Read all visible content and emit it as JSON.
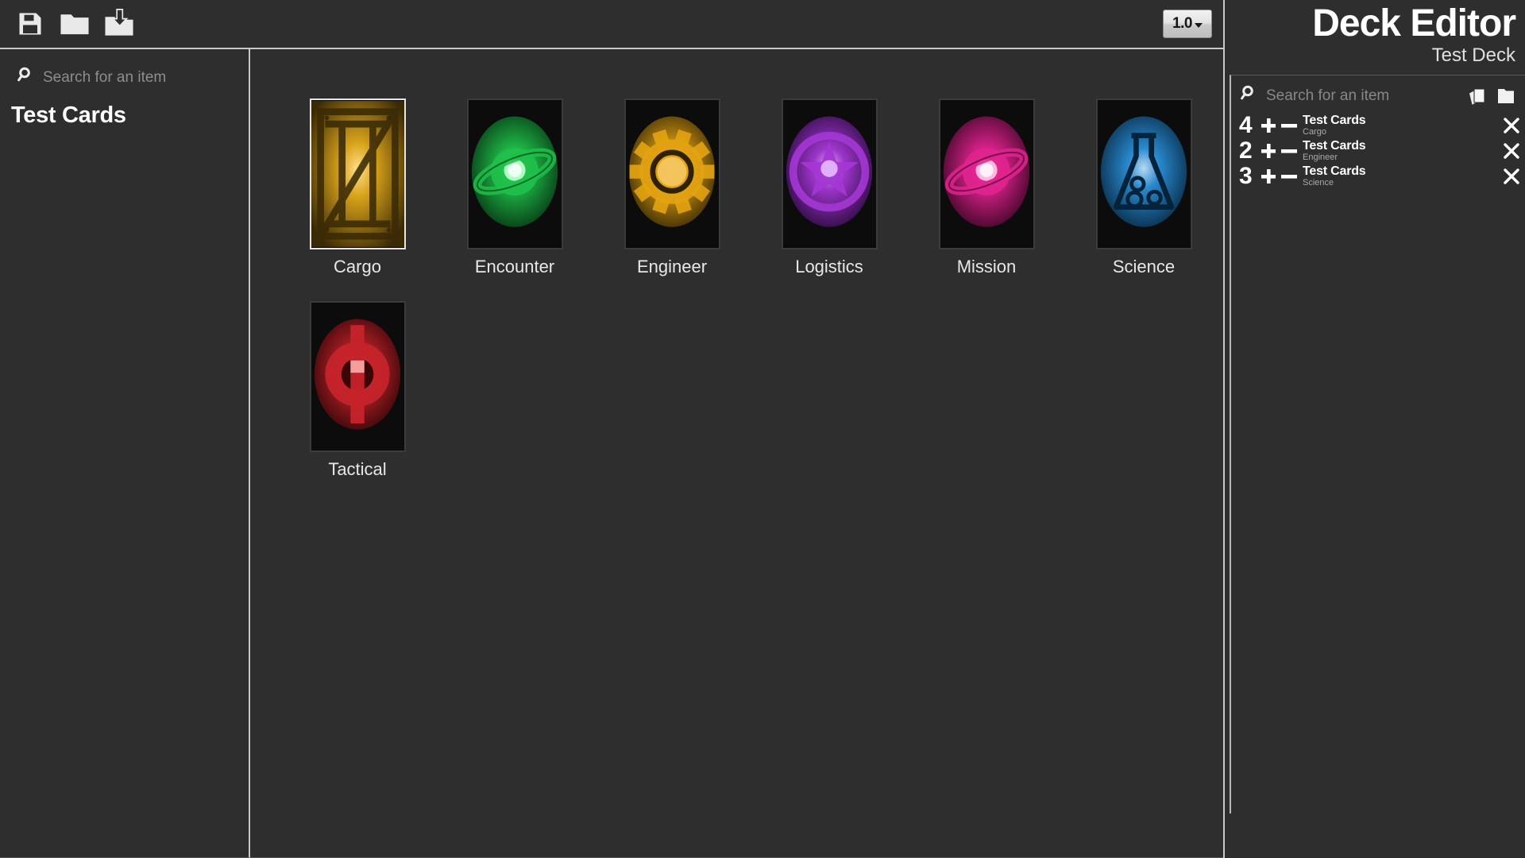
{
  "window": {
    "title": "Deck Editor",
    "background": "#2b2b2b",
    "panel_bg": "#2e2e2e",
    "divider": "#c9c9c9"
  },
  "toolbar": {
    "save_icon": "save-icon",
    "open_icon": "folder-open-icon",
    "import_icon": "import-icon",
    "version": {
      "label": "1.0",
      "caret": "chevron-down-icon"
    }
  },
  "sidebar": {
    "search": {
      "icon": "search-icon",
      "placeholder": "Search for an item",
      "value": ""
    },
    "heading": "Test Cards"
  },
  "grid": {
    "cards": [
      {
        "label": "Cargo",
        "art": "crate-icon",
        "color": "#d9a31a",
        "glow": "#ffe08a",
        "dark": "#3a2a06",
        "selected": true
      },
      {
        "label": "Encounter",
        "art": "planet-icon",
        "color": "#1fbf4a",
        "glow": "#b6ffca",
        "dark": "#042e10",
        "selected": false
      },
      {
        "label": "Engineer",
        "art": "gear-icon",
        "color": "#e3a312",
        "glow": "#ffdf95",
        "dark": "#2e2104",
        "selected": false
      },
      {
        "label": "Logistics",
        "art": "star-icon",
        "color": "#a437d4",
        "glow": "#e8bdff",
        "dark": "#230636",
        "selected": false
      },
      {
        "label": "Mission",
        "art": "planet-icon",
        "color": "#e0238e",
        "glow": "#ffc1e4",
        "dark": "#330320",
        "selected": false
      },
      {
        "label": "Science",
        "art": "flask-icon",
        "color": "#2a8fd8",
        "glow": "#bfe4ff",
        "dark": "#05243c",
        "selected": false
      },
      {
        "label": "Tactical",
        "art": "crosshair-icon",
        "color": "#c6232a",
        "glow": "#ffb3b3",
        "dark": "#2e0406",
        "selected": false
      }
    ]
  },
  "deck_editor": {
    "title": "Deck Editor",
    "deck_name": "Test Deck",
    "search": {
      "icon": "search-icon",
      "placeholder": "Search for an item",
      "value": ""
    },
    "actions": [
      {
        "name": "cards-stack-icon"
      },
      {
        "name": "folder-icon"
      }
    ],
    "entries": [
      {
        "qty": "4",
        "name": "Test Cards",
        "category": "Cargo"
      },
      {
        "qty": "2",
        "name": "Test Cards",
        "category": "Engineer"
      },
      {
        "qty": "3",
        "name": "Test Cards",
        "category": "Science"
      }
    ],
    "stepper": {
      "plus": "+",
      "minus": "—"
    },
    "remove_icon": "close-icon"
  }
}
